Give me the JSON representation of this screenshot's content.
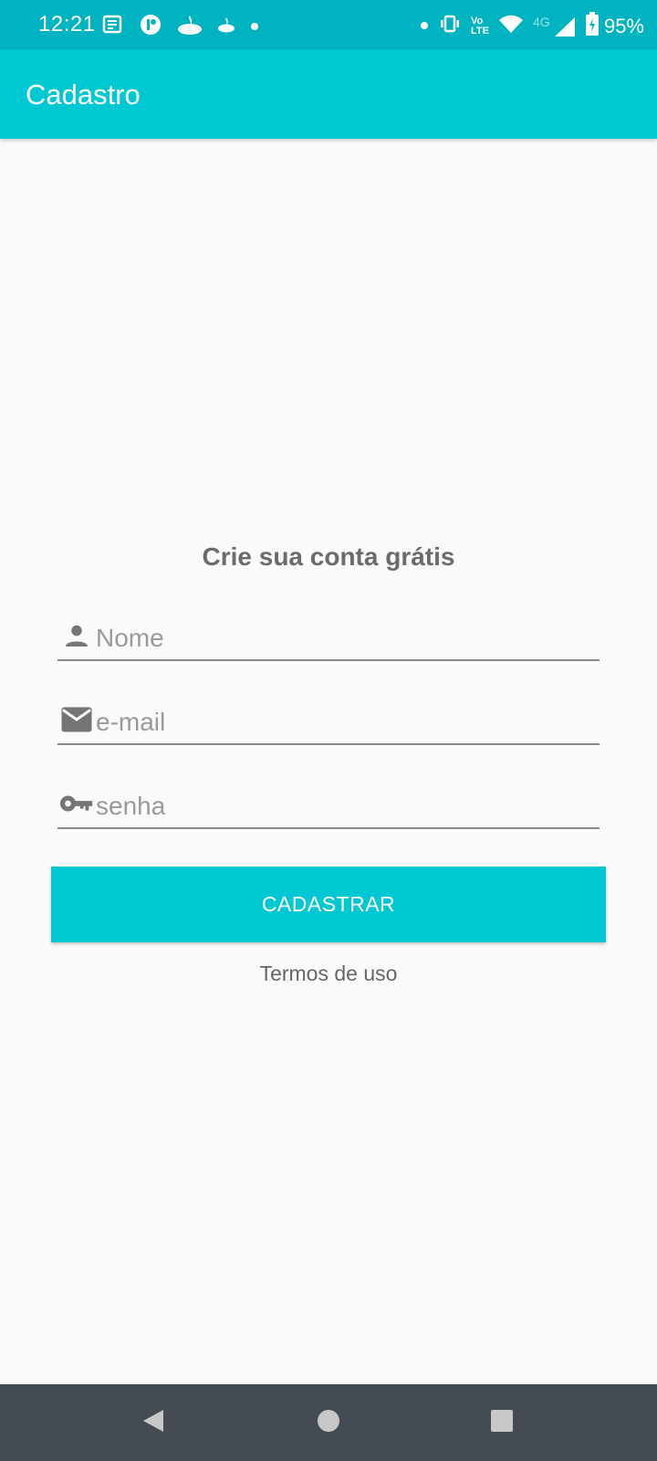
{
  "status_bar": {
    "time": "12:21",
    "battery_percent": "95%",
    "left_icons": [
      "news-icon",
      "app-icon",
      "santander-icon",
      "santander-small-icon",
      "notification-dot-icon"
    ],
    "right_icons": [
      "notification-dot-icon",
      "vibrate-icon",
      "volte-icon",
      "wifi-icon",
      "signal-4g-icon",
      "battery-charging-icon"
    ],
    "network_label": "4G",
    "volte_label_top": "Vo",
    "volte_label_bottom": "LTE"
  },
  "app_bar": {
    "title": "Cadastro"
  },
  "form": {
    "heading": "Crie sua conta grátis",
    "name_placeholder": "Nome",
    "email_placeholder": "e-mail",
    "password_placeholder": "senha",
    "submit_label": "CADASTRAR",
    "terms_label": "Termos de uso"
  },
  "colors": {
    "status_bar": "#00b3c0",
    "accent": "#00c8d3",
    "nav_bar": "#444b52",
    "text_gray": "#6b6b6b"
  }
}
